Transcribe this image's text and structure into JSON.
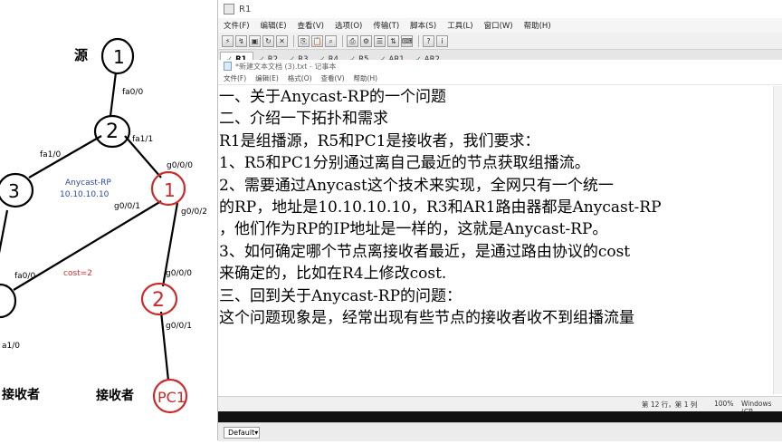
{
  "whiteboard": {
    "labels": {
      "source": "源",
      "n1": "1",
      "n2": "2",
      "n3": "3",
      "n4": "1",
      "n5": "2",
      "pc1": "PC1",
      "fa00_top": "fa0/0",
      "fa11": "fa1/1",
      "fa10": "fa1/0",
      "g000_a": "g0/0/0",
      "g001_a": "g0/0/1",
      "g002": "g0/0/2",
      "anycast": "Anycast-RP",
      "anycast_ip": "10.10.10.10",
      "fa00_left": "fa0/0",
      "cost": "cost=2",
      "g000_b": "g0/0/0",
      "g001_b": "g0/0/1",
      "fa10_bottom": "a1/0",
      "receiver_left": "接收者",
      "receiver_right": "接收者"
    },
    "colors": {
      "anycast": "#2a4aa8",
      "cost": "#d23030",
      "red_node": "#cc2a2a"
    }
  },
  "app": {
    "title": "R1",
    "menu": [
      "文件(F)",
      "编辑(E)",
      "查看(V)",
      "选项(O)",
      "传输(T)",
      "脚本(S)",
      "工具(L)",
      "窗口(W)",
      "帮助(H)"
    ],
    "tabs": [
      "R1",
      "R2",
      "R3",
      "R4",
      "R5",
      "AR1",
      "AR2"
    ],
    "active_tab": "R1"
  },
  "notepad": {
    "title": "*新建文本文档 (3).txt - 记事本",
    "menu": [
      "文件(F)",
      "编辑(E)",
      "格式(O)",
      "查看(V)",
      "帮助(H)"
    ],
    "lines": [
      "一、关于Anycast-RP的一个问题",
      "二、介绍一下拓扑和需求",
      "R1是组播源，R5和PC1是接收者，我们要求：",
      "1、R5和PC1分别通过离自己最近的节点获取组播流。",
      "2、需要通过Anycast这个技术来实现，全网只有一个统一",
      "的RP，地址是10.10.10.10，R3和AR1路由器都是Anycast-RP",
      "，他们作为RP的IP地址是一样的，这就是Anycast-RP。",
      "3、如何确定哪个节点离接收者最近，是通过路由协议的cost",
      "来确定的，比如在R4上修改cost.",
      "三、回到关于Anycast-RP的问题：",
      "这个问题现象是，经常出现有些节点的接收者收不到组播流量"
    ],
    "status": {
      "position": "第 12 行，第 1 列",
      "zoom": "100%",
      "encoding": "Windows (CR"
    }
  },
  "bottom": {
    "dropdown": "Default"
  }
}
